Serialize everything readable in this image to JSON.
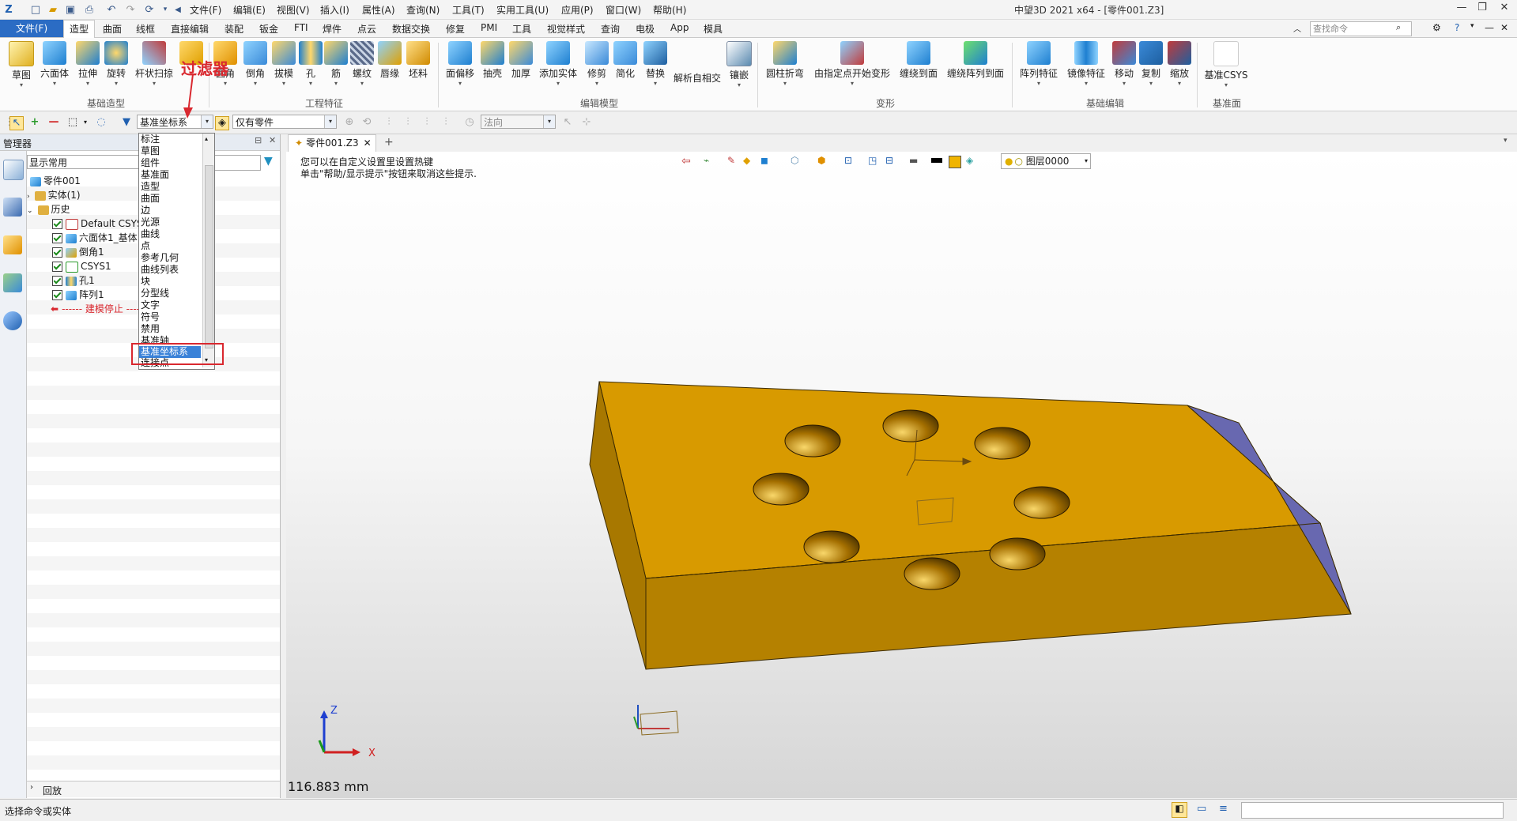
{
  "titlebar": {
    "menus": [
      "文件(F)",
      "编辑(E)",
      "视图(V)",
      "插入(I)",
      "属性(A)",
      "查询(N)",
      "工具(T)",
      "实用工具(U)",
      "应用(P)",
      "窗口(W)",
      "帮助(H)"
    ],
    "title": "中望3D 2021 x64 - [零件001.Z3]",
    "window_buttons": [
      "—",
      "❐",
      "✕"
    ]
  },
  "ribbon_tabs": {
    "file": "文件(F)",
    "tabs": [
      "造型",
      "曲面",
      "线框",
      "直接编辑",
      "装配",
      "钣金",
      "FTI",
      "焊件",
      "点云",
      "数据交换",
      "修复",
      "PMI",
      "工具",
      "视觉样式",
      "查询",
      "电极",
      "App",
      "模具"
    ],
    "search_placeholder": "查找命令"
  },
  "ribbon": {
    "buttons": [
      "草图",
      "六面体",
      "拉伸",
      "旋转",
      "杆状扫掠",
      "",
      "圆角",
      "倒角",
      "拔模",
      "孔",
      "筋",
      "螺纹",
      "唇缘",
      "坯料",
      "面偏移",
      "抽壳",
      "加厚",
      "添加实体",
      "修剪",
      "简化",
      "替换",
      "解析自相交",
      "镶嵌",
      "圆柱折弯",
      "由指定点开始变形",
      "缠绕到面",
      "缠绕阵列到面",
      "阵列特征",
      "镜像特征",
      "移动",
      "复制",
      "缩放",
      "基准CSYS"
    ],
    "groups": [
      "基础造型",
      "工程特征",
      "编辑模型",
      "变形",
      "基础编辑",
      "基准面"
    ],
    "annotation": "过滤器",
    "colors": {
      "accent": "#2b6cc4",
      "annotation": "#d9282f"
    }
  },
  "toolbar2": {
    "filter_value": "基准坐标系",
    "scope_value": "仅有零件",
    "normal_value": "法向"
  },
  "panel": {
    "title": "管理器",
    "display_combo": "显示常用",
    "tree": {
      "root": "零件001",
      "solid": "实体(1)",
      "history": "历史",
      "items": [
        "Default CSYS",
        "六面体1_基体",
        "倒角1",
        "CSYS1",
        "孔1",
        "阵列1"
      ],
      "stop": "------ 建模停止 -----"
    },
    "footer": "回放"
  },
  "dropdown": {
    "items": [
      "标注",
      "草图",
      "组件",
      "基准面",
      "造型",
      "曲面",
      "边",
      "光源",
      "曲线",
      "点",
      "参考几何",
      "曲线列表",
      "块",
      "分型线",
      "文字",
      "符号",
      "禁用",
      "基准轴",
      "基准坐标系",
      "连接点"
    ],
    "selected": "基准坐标系"
  },
  "viewport": {
    "doc_tab": "零件001.Z3",
    "hint_line1": "您可以在自定义设置里设置热键",
    "hint_line2": "单击\"帮助/显示提示\"按钮来取消这些提示.",
    "layer": "图层0000",
    "measure": "116.883 mm",
    "axis_labels": {
      "x": "X",
      "y": "Y",
      "z": "Z"
    },
    "part_colors": {
      "top": "#d89a00",
      "front": "#b58100",
      "left": "#a87800",
      "right": "#6868b0"
    }
  },
  "status": {
    "text": "选择命令或实体"
  }
}
